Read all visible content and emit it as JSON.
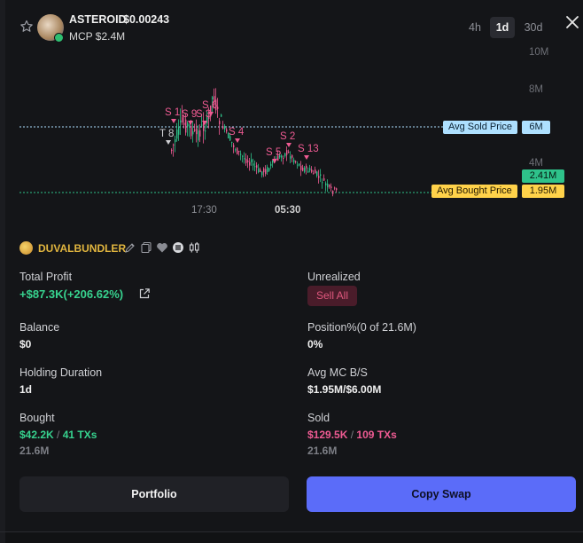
{
  "header": {
    "token_name": "ASTEROID",
    "token_price": "$0.00243",
    "mcp": "MCP $2.4M",
    "timeframes": [
      "4h",
      "1d",
      "30d"
    ],
    "active_timeframe": "1d"
  },
  "chart": {
    "y_ticks": [
      "10M",
      "8M",
      "6M",
      "4M"
    ],
    "x_ticks": [
      "17:30",
      "05:30"
    ],
    "avg_sold_label": "Avg Sold Price",
    "avg_sold_value": "6M",
    "avg_bought_label": "Avg Bought Price",
    "avg_bought_value": "1.95M",
    "current_value": "2.41M",
    "markers": [
      "T 8",
      "S 1",
      "S 9",
      "S 3",
      "S 6",
      "S 4",
      "S 5",
      "S 2",
      "S 13"
    ],
    "colors": {
      "sold_line": "#aee0ff",
      "bought_line": "#2ec28a",
      "up": "#2ec28a",
      "down": "#ef5b93",
      "marker": "#ef5b93"
    }
  },
  "wallet": {
    "name": "DUVALBUNDLER"
  },
  "stats": {
    "total_profit_label": "Total Profit",
    "total_profit_value": "+$87.3K(+206.62%)",
    "unrealized_label": "Unrealized",
    "sell_all_label": "Sell All",
    "balance_label": "Balance",
    "balance_value": "$0",
    "position_label": "Position%(0 of 21.6M)",
    "position_value": "0%",
    "holding_label": "Holding Duration",
    "holding_value": "1d",
    "avg_mc_label": "Avg MC B/S",
    "avg_mc_value": "$1.95M/$6.00M",
    "bought_label": "Bought",
    "bought_amount": "$42.2K",
    "bought_sep": "/",
    "bought_txs": "41 TXs",
    "bought_tokens": "21.6M",
    "sold_label": "Sold",
    "sold_amount": "$129.5K",
    "sold_sep": "/",
    "sold_txs": "109 TXs",
    "sold_tokens": "21.6M"
  },
  "buttons": {
    "portfolio": "Portfolio",
    "copy_swap": "Copy Swap"
  }
}
